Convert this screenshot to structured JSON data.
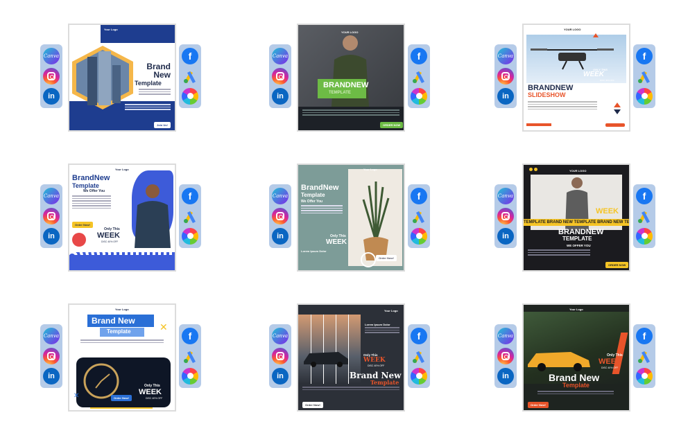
{
  "icons": {
    "left": [
      "canva-icon",
      "instagram-icon",
      "linkedin-icon"
    ],
    "right": [
      "facebook-icon",
      "google-ads-icon",
      "color-palette-icon"
    ],
    "canva_label": "Canva",
    "linkedin_label": "in",
    "facebook_label": "f"
  },
  "cards": [
    {
      "logo": "Your Logo",
      "title1": "Brand",
      "title2": "New",
      "title3": "Template",
      "tagline": "Lorem Ipsum Dolor",
      "btn": "Join Us!"
    },
    {
      "logo": "YOUR LOGO",
      "title1": "BRANDNEW",
      "title2": "TEMPLATE",
      "btn": "ORDER NOW"
    },
    {
      "logo": "YOUR LOGO",
      "sub1": "ONLY THIS",
      "sub2": "WEEK",
      "sub3": "DISC 40% OFF",
      "title1": "BRANDNEW",
      "title2": "SLIDESHOW"
    },
    {
      "logo": "Your Logo",
      "title1": "BrandNew",
      "title2": "Template",
      "offer": "We Offer You",
      "btn": "Order Now!",
      "sub1": "Only This",
      "sub2": "WEEK",
      "sub3": "DISC 40% OFF"
    },
    {
      "logo": "Your Logo",
      "title1": "BrandNew",
      "title2": "Template",
      "offer": "We Offer You",
      "sub1": "Only This",
      "sub2": "WEEK",
      "tagline": "Lorem Ipsum Dolor",
      "btn": "Order Now!"
    },
    {
      "logo": "YOUR LOGO",
      "sub2": "WEEK",
      "strip": "TEMPLATE BRAND NEW TEMPLATE BRAND NEW TEMPLATE BRAND NEW TEMP",
      "title1": "BRANDNEW",
      "title2": "TEMPLATE",
      "offer": "WE OFFER YOU",
      "btn": "ORDER NOW"
    },
    {
      "logo": "Your Logo",
      "title1": "Brand New",
      "title2": "Template",
      "sub1": "Only This",
      "sub2": "WEEK",
      "sub3": "DISC 40% OFF",
      "btn": "Order Now!"
    },
    {
      "logo": "Your Logo",
      "tagline": "Lorem Ipsum Dolor",
      "sub1": "Only This",
      "sub2": "WEEK",
      "sub3": "DISC 40% OFF",
      "title1": "Brand New",
      "title2": "Template",
      "btn": "Order Now!"
    },
    {
      "logo": "Your Logo",
      "sub1": "Only This",
      "sub2": "WEEK",
      "sub3": "DISC 40% OFF",
      "title1": "Brand New",
      "title2": "Template",
      "btn": "Order Now!"
    }
  ]
}
